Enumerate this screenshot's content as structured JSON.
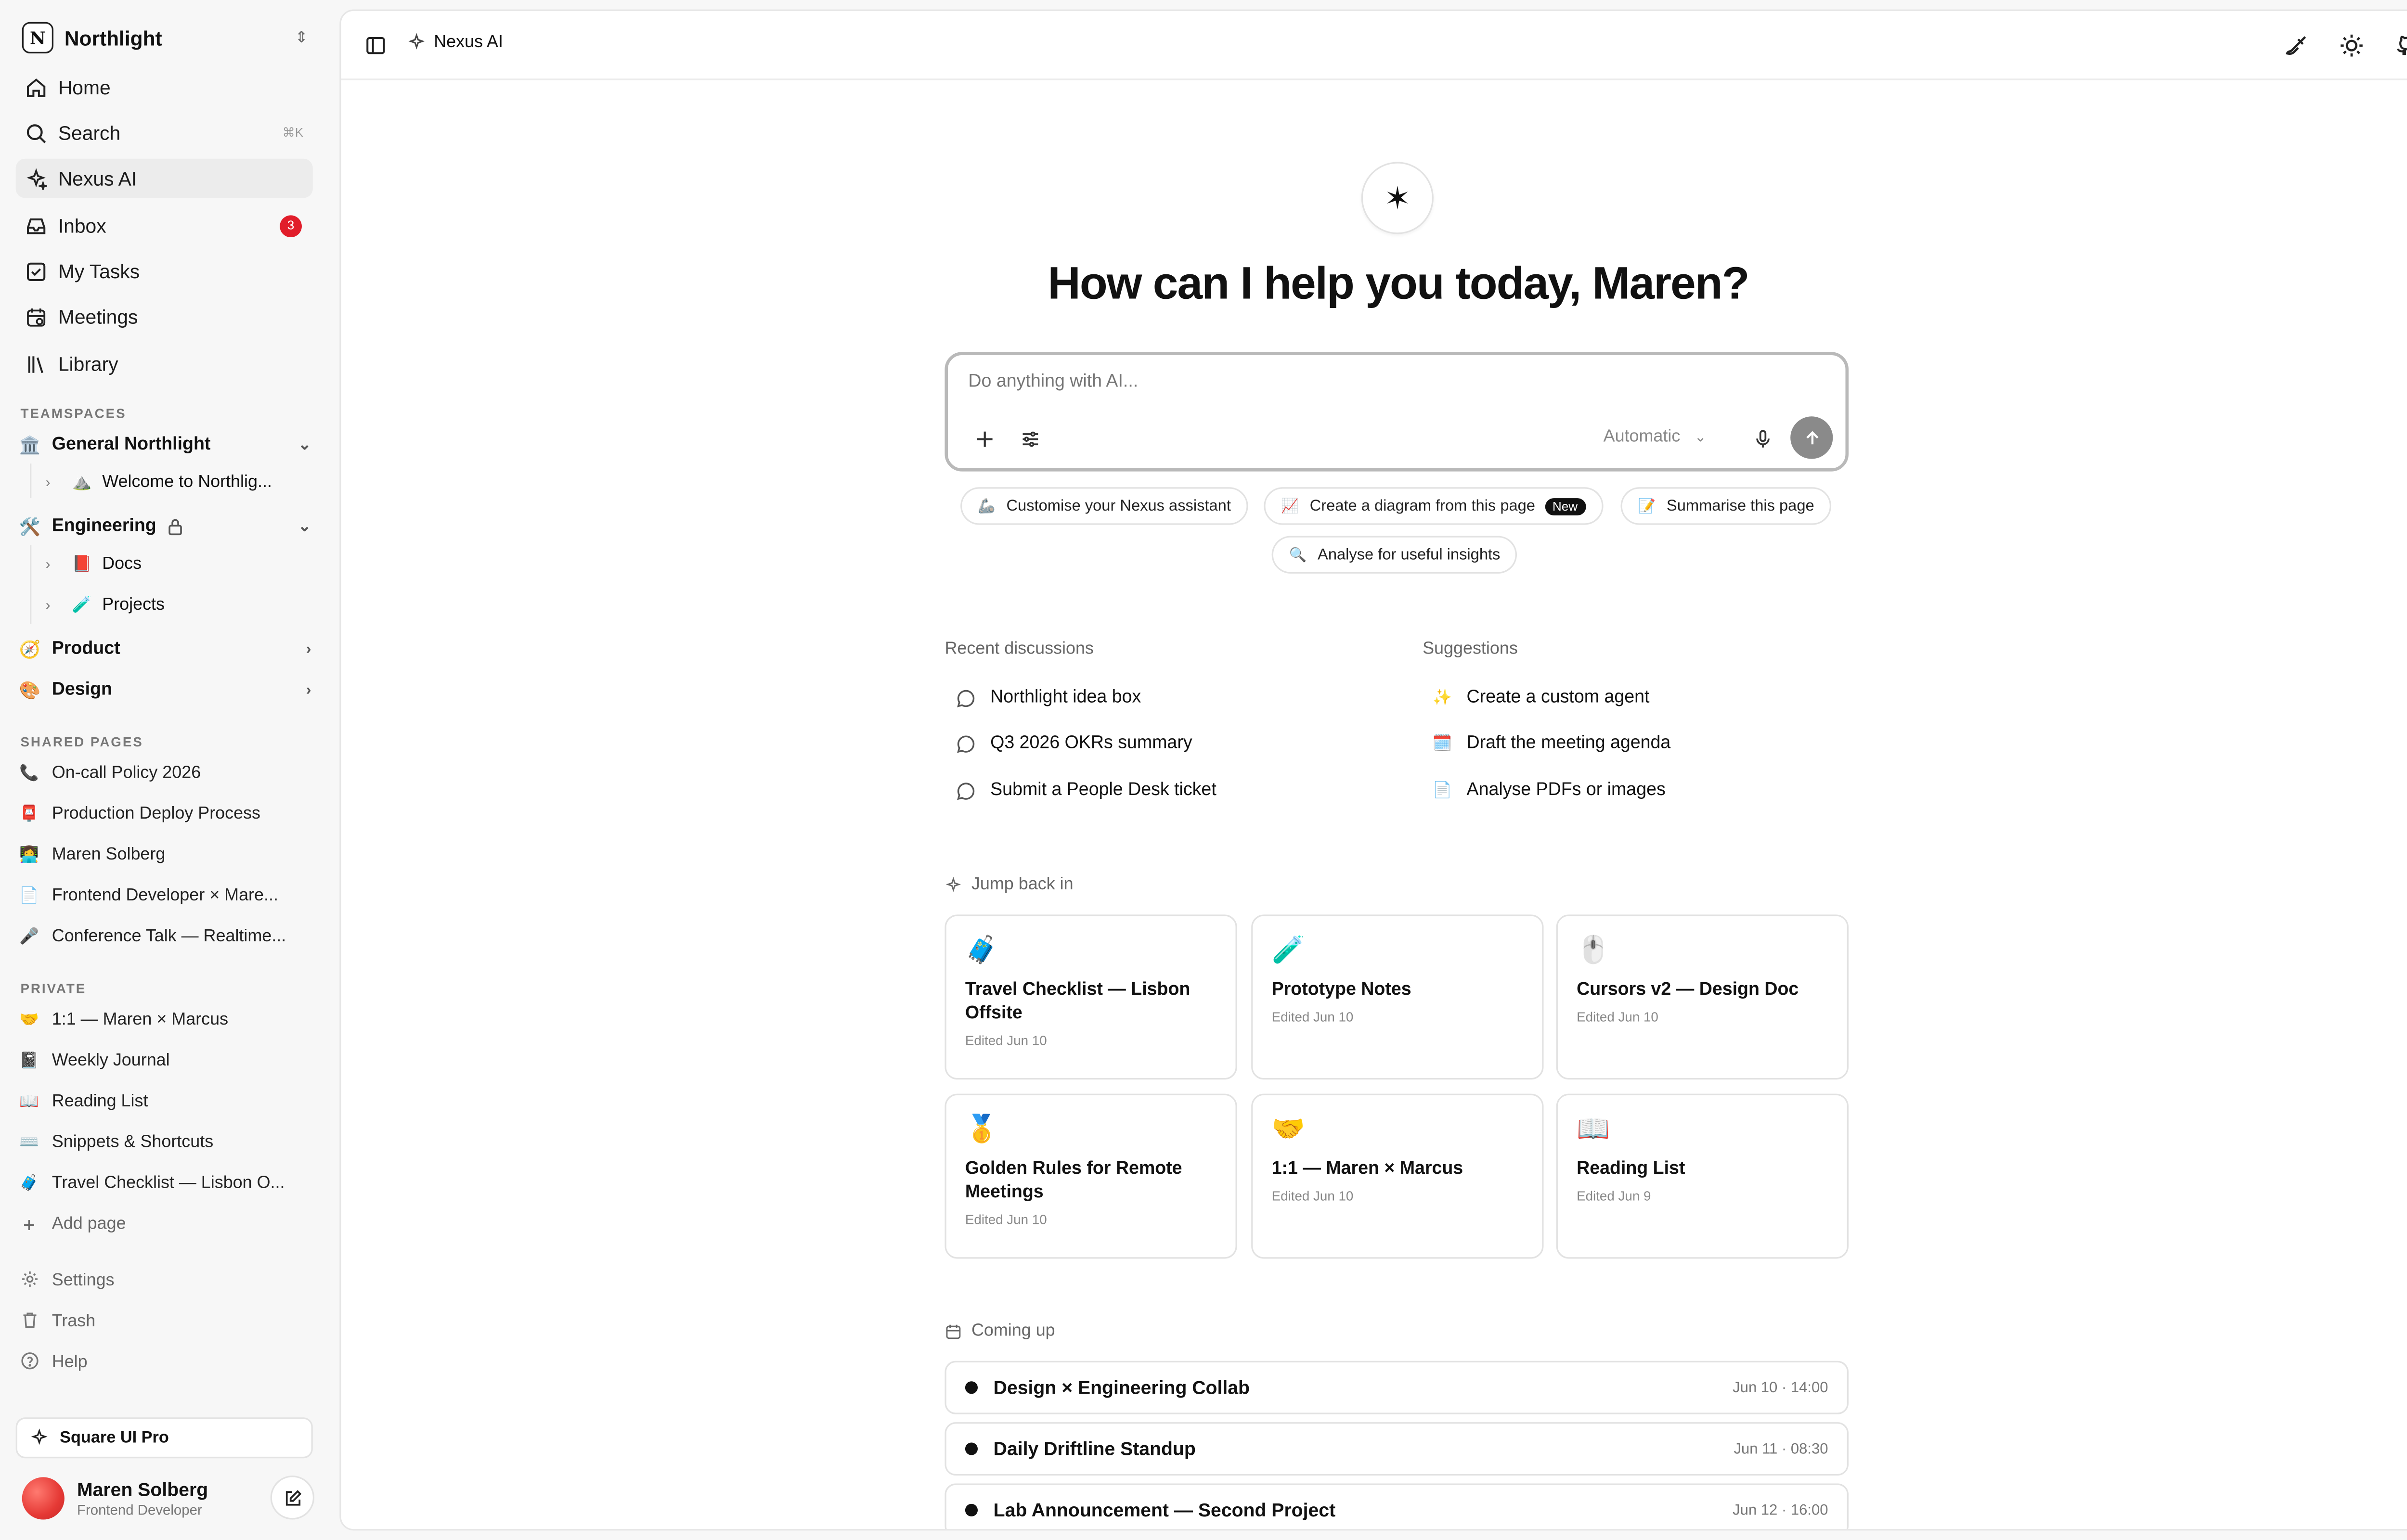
{
  "workspace": {
    "logo": "N",
    "name": "Northlight"
  },
  "nav": [
    {
      "label": "Home"
    },
    {
      "label": "Search",
      "shortcut": "⌘K"
    },
    {
      "label": "Nexus AI"
    },
    {
      "label": "Inbox",
      "badge": "3"
    },
    {
      "label": "My Tasks"
    },
    {
      "label": "Meetings"
    },
    {
      "label": "Library"
    }
  ],
  "teamspaces": {
    "heading": "TEAMSPACES",
    "items": [
      {
        "emoji": "🏛️",
        "label": "General Northlight"
      },
      {
        "emoji": "🛠️",
        "label": "Engineering"
      },
      {
        "emoji": "🧭",
        "label": "Product"
      },
      {
        "emoji": "🎨",
        "label": "Design"
      }
    ],
    "children": [
      {
        "emoji": "⛰️",
        "label": "Welcome to Northlig..."
      },
      {
        "emoji": "📕",
        "label": "Docs"
      },
      {
        "emoji": "🧪",
        "label": "Projects"
      }
    ]
  },
  "shared": {
    "heading": "SHARED PAGES",
    "items": [
      {
        "emoji": "📞",
        "label": "On-call Policy 2026"
      },
      {
        "emoji": "📮",
        "label": "Production Deploy Process"
      },
      {
        "emoji": "👩‍💻",
        "label": "Maren Solberg"
      },
      {
        "emoji": "📄",
        "label": "Frontend Developer × Mare..."
      },
      {
        "emoji": "🎤",
        "label": "Conference Talk — Realtime..."
      }
    ]
  },
  "private": {
    "heading": "PRIVATE",
    "items": [
      {
        "emoji": "🤝",
        "label": "1:1 — Maren × Marcus"
      },
      {
        "emoji": "📓",
        "label": "Weekly Journal"
      },
      {
        "emoji": "📖",
        "label": "Reading List"
      },
      {
        "emoji": "⌨️",
        "label": "Snippets & Shortcuts"
      },
      {
        "emoji": "🧳",
        "label": "Travel Checklist — Lisbon O..."
      }
    ],
    "add_page": "Add page"
  },
  "footer_nav": [
    {
      "label": "Settings"
    },
    {
      "label": "Trash"
    },
    {
      "label": "Help"
    }
  ],
  "upgrade": {
    "label": "Square UI Pro"
  },
  "user": {
    "name": "Maren Solberg",
    "role": "Frontend Developer"
  },
  "topbar": {
    "crumb": "Nexus AI"
  },
  "hero": {
    "star": "✶",
    "title": "How can I help you today, Maren?"
  },
  "prompt": {
    "placeholder": "Do anything with AI...",
    "model": "Automatic"
  },
  "chips": [
    {
      "emoji": "🦾",
      "label": "Customise your Nexus assistant"
    },
    {
      "emoji": "📈",
      "label": "Create a diagram from this page",
      "tag": "New"
    },
    {
      "emoji": "📝",
      "label": "Summarise this page"
    },
    {
      "emoji": "🔍",
      "label": "Analyse for useful insights"
    }
  ],
  "recent": {
    "heading": "Recent discussions",
    "items": [
      "Northlight idea box",
      "Q3 2026 OKRs summary",
      "Submit a People Desk ticket"
    ]
  },
  "suggestions": {
    "heading": "Suggestions",
    "items": [
      {
        "emoji": "✨",
        "label": "Create a custom agent"
      },
      {
        "emoji": "🗓️",
        "label": "Draft the meeting agenda"
      },
      {
        "emoji": "📄",
        "label": "Analyse PDFs or images"
      }
    ]
  },
  "jump": {
    "heading": "Jump back in",
    "cards": [
      {
        "emoji": "🧳",
        "title": "Travel Checklist — Lisbon Offsite",
        "edited": "Edited Jun 10"
      },
      {
        "emoji": "🧪",
        "title": "Prototype Notes",
        "edited": "Edited Jun 10"
      },
      {
        "emoji": "🖱️",
        "title": "Cursors v2 — Design Doc",
        "edited": "Edited Jun 10"
      },
      {
        "emoji": "🥇",
        "title": "Golden Rules for Remote Meetings",
        "edited": "Edited Jun 10"
      },
      {
        "emoji": "🤝",
        "title": "1:1 — Maren × Marcus",
        "edited": "Edited Jun 10"
      },
      {
        "emoji": "📖",
        "title": "Reading List",
        "edited": "Edited Jun 9"
      }
    ]
  },
  "coming": {
    "heading": "Coming up",
    "events": [
      {
        "title": "Design × Engineering Collab",
        "time": "Jun 10 · 14:00"
      },
      {
        "title": "Daily Driftline Standup",
        "time": "Jun 11 · 08:30"
      },
      {
        "title": "Lab Announcement — Second Project",
        "time": "Jun 12 · 16:00"
      }
    ]
  },
  "colors": {
    "accent": "#111111",
    "badge": "#e11d2a",
    "send": "#8a8a8a",
    "avatar": "#e53935"
  }
}
